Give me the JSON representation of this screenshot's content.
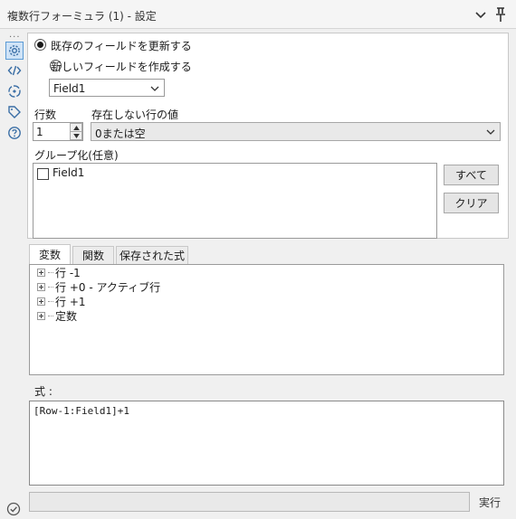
{
  "window": {
    "title": "複数行フォーミュラ (1) - 設定"
  },
  "sidebar": {
    "overflow": "...",
    "icons": [
      "gear-icon",
      "code-icon",
      "target-icon",
      "tag-icon",
      "help-icon"
    ]
  },
  "options": {
    "update_existing_label": "既存のフィールドを更新する",
    "create_new_label": "新しいフィールドを作成する",
    "selected_option": "update_existing",
    "field_select_value": "Field1"
  },
  "rows": {
    "rows_label": "行数",
    "rows_value": "1",
    "missing_label": "存在しない行の値",
    "missing_value": "0または空"
  },
  "grouping": {
    "label": "グループ化(任意)",
    "items": [
      {
        "label": "Field1",
        "checked": false
      }
    ],
    "all_button": "すべて",
    "clear_button": "クリア"
  },
  "tabs": [
    {
      "label": "変数",
      "active": true
    },
    {
      "label": "関数",
      "active": false
    },
    {
      "label": "保存された式",
      "active": false
    }
  ],
  "tree": {
    "items": [
      "行 -1",
      "行 +0 - アクティブ行",
      "行 +1",
      "定数"
    ]
  },
  "expression": {
    "label": "式 :",
    "value": "[Row-1:Field1]+1"
  },
  "run": {
    "label": "実行",
    "input_value": ""
  },
  "colors": {
    "active_icon_bg": "#cfe3f7",
    "active_icon_border": "#5b9bd5"
  }
}
